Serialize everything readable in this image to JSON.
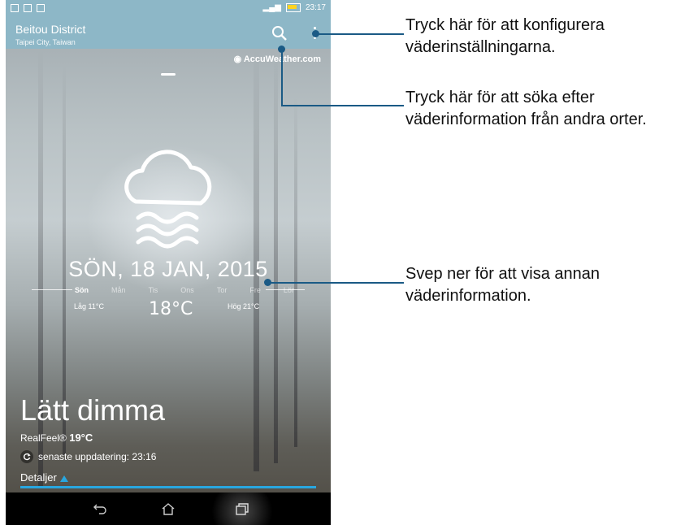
{
  "status_bar": {
    "time": "23:17"
  },
  "app_bar": {
    "city": "Beitou District",
    "region": "Taipei City, Taiwan"
  },
  "provider": "AccuWeather.com",
  "forecast": {
    "date": "SÖN, 18 JAN, 2015",
    "days": [
      "Sön",
      "Mån",
      "Tis",
      "Ons",
      "Tor",
      "Fre",
      "Lör"
    ],
    "low": "Låg 11°C",
    "temp": "18°C",
    "high": "Hög 21°C"
  },
  "condition": "Lätt dimma",
  "realfeel_label": "RealFeel®",
  "realfeel_value": "19°C",
  "update_text": "senaste uppdatering: 23:16",
  "details_label": "Detaljer",
  "callouts": {
    "settings": "Tryck här för att konfigurera väderinställningarna.",
    "search": "Tryck här för att söka efter väderinformation från andra orter.",
    "swipe": "Svep ner för att visa annan väderinformation."
  },
  "colors": {
    "accent": "#28a7e0",
    "appbar": "#8db7c7",
    "callout_line": "#1a5a85"
  }
}
